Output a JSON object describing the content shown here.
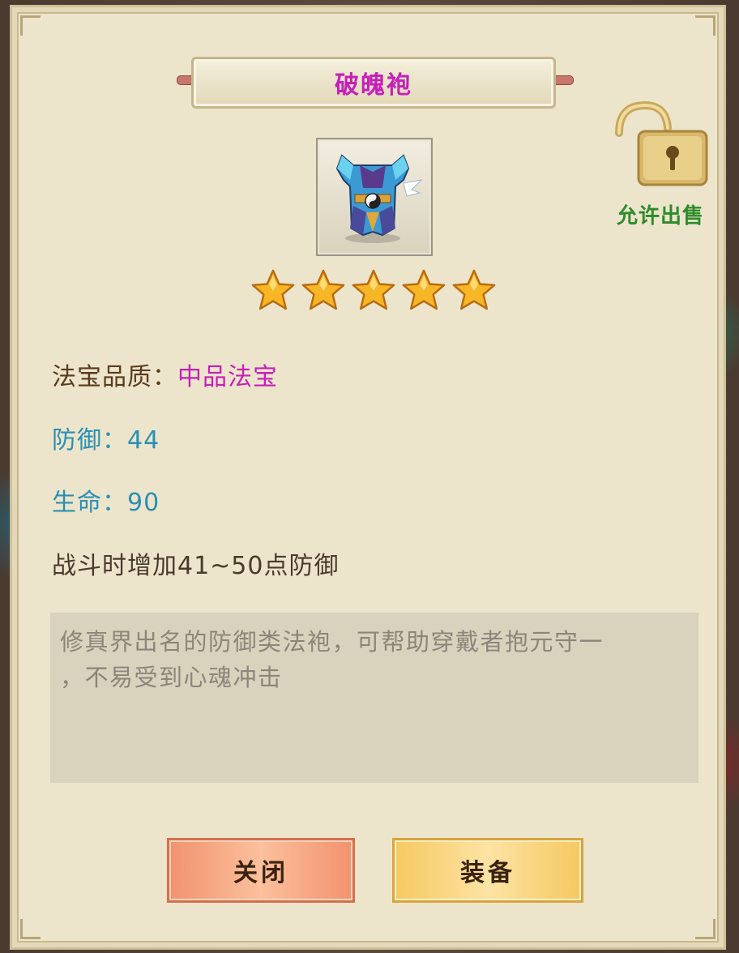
{
  "dialog": {
    "title": "破魄袍",
    "item_icon": "armor-robe-icon",
    "star_count": 5,
    "star_max": 5,
    "sell_lock": {
      "icon": "unlocked-padlock-icon",
      "label": "允许出售"
    }
  },
  "attributes": {
    "quality_label": "法宝品质：",
    "quality_value": "中品法宝",
    "defense": "防御：44",
    "health": "生命：90",
    "effect": "战斗时增加41~50点防御"
  },
  "description": {
    "line1": "修真界出名的防御类法袍，可帮助穿戴者抱元守一",
    "line2": "，不易受到心魂冲击"
  },
  "buttons": {
    "close_label": "关闭",
    "equip_label": "装备"
  },
  "colors": {
    "title": "#c61fb8",
    "quality_value": "#c61fb8",
    "stat": "#2a8fb2",
    "sell_label": "#2e8b2a"
  }
}
